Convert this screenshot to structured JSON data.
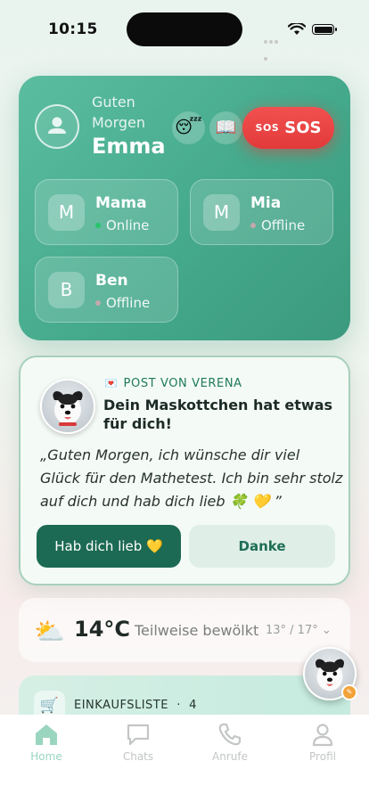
{
  "status_bar": {
    "time": "10:15"
  },
  "header": {
    "greeting": "Guten Morgen",
    "user_name": "Emma",
    "action_icons": [
      "😴",
      "📖"
    ],
    "sos": {
      "icon_text": "SOS",
      "label": "SOS"
    },
    "contacts": [
      {
        "initial": "M",
        "name": "Mama",
        "status": "Online"
      },
      {
        "initial": "M",
        "name": "Mia",
        "status": "Offline"
      },
      {
        "initial": "B",
        "name": "Ben",
        "status": "Offline"
      }
    ]
  },
  "post": {
    "from_label": "POST VON VERENA",
    "title": "Dein Maskottchen hat etwas für dich!",
    "message": "„Guten Morgen, ich wünsche dir viel Glück für den Mathetest. Ich bin sehr stolz auf dich und hab dich lieb 🍀 💛 ”",
    "primary_button": "Hab dich lieb 💛",
    "secondary_button": "Danke"
  },
  "weather": {
    "temperature": "14°C",
    "description": "Teilweise bewölkt",
    "range": "13° / 17°"
  },
  "shopping": {
    "label": "EINKAUFSLISTE",
    "separator": "·",
    "count": "4"
  },
  "tabs": [
    {
      "label": "Home",
      "icon": "home-icon",
      "active": true
    },
    {
      "label": "Chats",
      "icon": "chat-icon",
      "active": false
    },
    {
      "label": "Anrufe",
      "icon": "phone-icon",
      "active": false
    },
    {
      "label": "Profil",
      "icon": "profile-icon",
      "active": false
    }
  ],
  "colors": {
    "primary": "#45a98b",
    "sos": "#e23a3a",
    "dark_green": "#1c6a53",
    "online": "#27c46a"
  }
}
